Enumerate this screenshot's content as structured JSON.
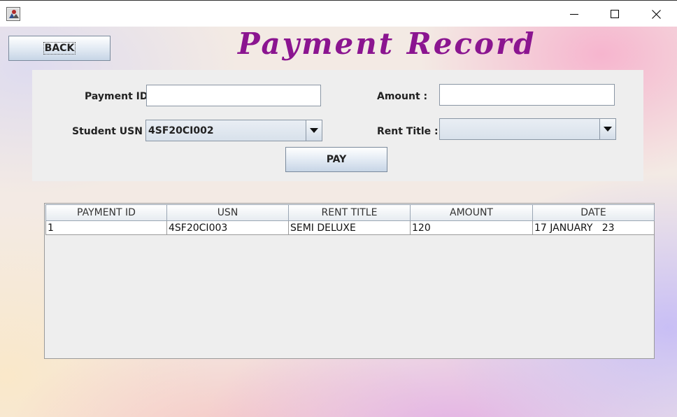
{
  "window": {
    "icon": "java-app-icon",
    "controls": [
      "minimize-icon",
      "maximize-icon",
      "close-icon"
    ]
  },
  "header": {
    "title": "Payment Record",
    "back_label": "BACK"
  },
  "form": {
    "payment_id_label": "Payment ID :",
    "payment_id_value": "",
    "amount_label": "Amount :",
    "amount_value": "",
    "student_usn_label": "Student USN :",
    "student_usn_selected": "4SF20CI002",
    "rent_title_label": "Rent Title :",
    "rent_title_selected": "",
    "pay_label": "PAY"
  },
  "table": {
    "columns": [
      "PAYMENT ID",
      "USN",
      "RENT TITLE",
      "AMOUNT",
      "DATE"
    ],
    "rows": [
      [
        "1",
        "4SF20CI003",
        "SEMI DELUXE",
        "120",
        "17 JANUARY   23"
      ]
    ]
  },
  "colors": {
    "title": "#8b1590",
    "panel": "#eeeeee",
    "button_gradient_end": "#c7d5e6"
  }
}
